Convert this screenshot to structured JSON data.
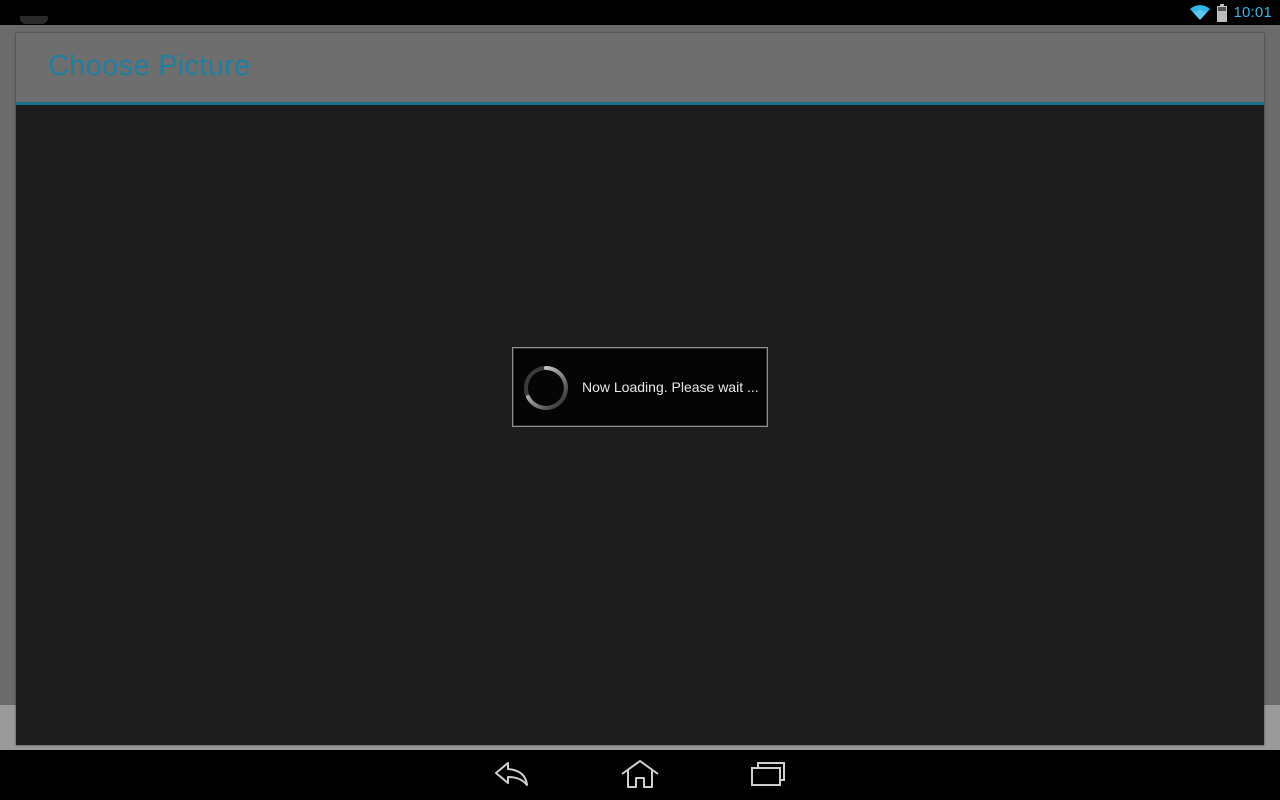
{
  "status_bar": {
    "time": "10:01",
    "icons": [
      "wifi-icon",
      "battery-icon"
    ],
    "accent_color": "#33b5e5"
  },
  "dialog": {
    "title": "Choose Picture",
    "title_color": "#1f7fa0",
    "divider_color": "#1a6f8c"
  },
  "loading": {
    "message": "Now Loading. Please wait ...",
    "icon": "spinner-icon"
  },
  "nav_bar": {
    "buttons": [
      "back-icon",
      "home-icon",
      "recent-apps-icon"
    ]
  }
}
